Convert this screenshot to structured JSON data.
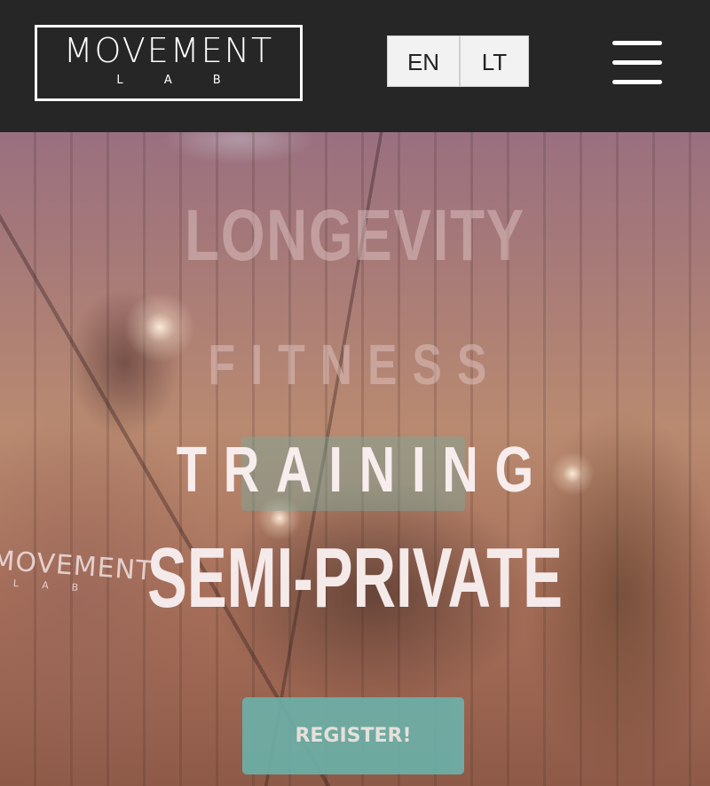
{
  "header": {
    "logo_main": "MOVEMENT",
    "logo_sub": "LAB",
    "languages": [
      "EN",
      "LT"
    ],
    "menu_icon": "hamburger-menu-icon"
  },
  "hero": {
    "ghost_line_1": "LONGEVITY",
    "ghost_line_2": "FITNESS",
    "title_line_1": "TRAINING",
    "title_line_2": "SEMI-PRIVATE",
    "cta_label": "REGISTER!",
    "wall_logo_main": "MOVEMENT",
    "wall_logo_sub": "LAB"
  },
  "colors": {
    "header_bg": "#262626",
    "cta_bg": "#6cb0a8",
    "overlay": "#b98a70"
  }
}
